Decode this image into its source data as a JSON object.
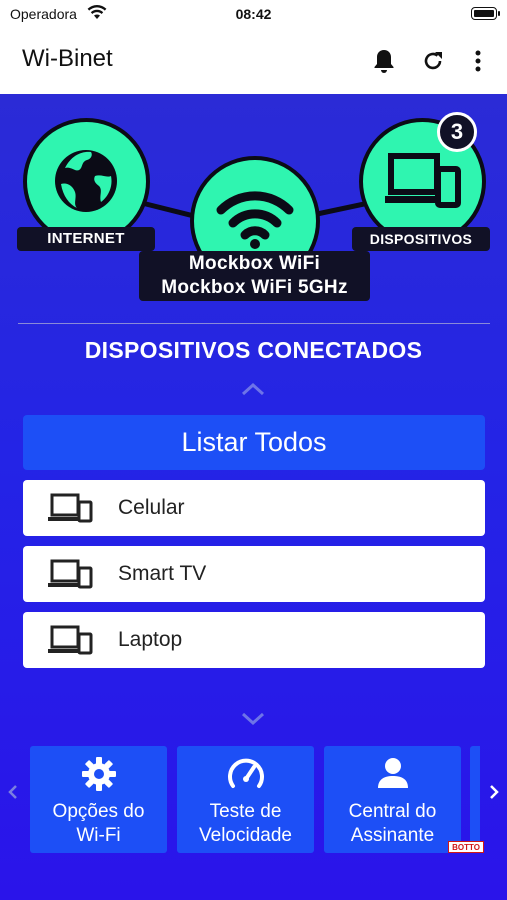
{
  "status_bar": {
    "carrier": "Operadora",
    "time": "08:42"
  },
  "app_bar": {
    "title": "Wi-Binet",
    "actions": [
      "bell-icon",
      "refresh-icon",
      "more-vert-icon"
    ]
  },
  "topology": {
    "internet_label": "INTERNET",
    "devices_label": "DISPOSITIVOS",
    "devices_count": "3",
    "wifi_names": [
      "Mockbox WiFi",
      "Mockbox WiFi 5GHz"
    ]
  },
  "connected": {
    "title": "DISPOSITIVOS CONECTADOS",
    "list_all_label": "Listar Todos",
    "devices": [
      {
        "label": "Celular",
        "icon": "devices-icon"
      },
      {
        "label": "Smart TV",
        "icon": "devices-icon"
      },
      {
        "label": "Laptop",
        "icon": "devices-icon"
      }
    ]
  },
  "shortcuts": [
    {
      "label_line1": "Opções do",
      "label_line2": "Wi-Fi",
      "icon": "gear-icon"
    },
    {
      "label_line1": "Teste de",
      "label_line2": "Velocidade",
      "icon": "speedometer-icon"
    },
    {
      "label_line1": "Central do",
      "label_line2": "Assinante",
      "icon": "person-icon"
    }
  ],
  "watermark": "BOTTO",
  "colors": {
    "accent_green": "#2ff5b0",
    "button_blue": "#1d4ff6",
    "background_blue": "#2424e6",
    "label_dark": "#111126"
  }
}
